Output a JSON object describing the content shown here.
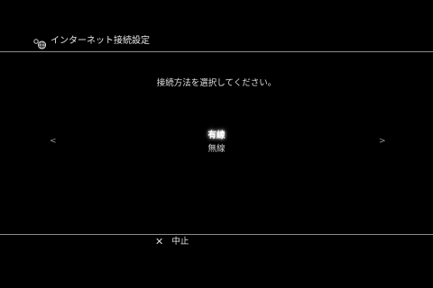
{
  "header": {
    "icon": "network-settings-icon",
    "title": "インターネット接続設定"
  },
  "main": {
    "prompt": "接続方法を選択してください。",
    "options": [
      {
        "label": "有線",
        "selected": true
      },
      {
        "label": "無線",
        "selected": false
      }
    ],
    "left_arrow": "<",
    "right_arrow": ">"
  },
  "footer": {
    "cancel_icon": "cross-button-icon",
    "cancel_glyph": "✕",
    "cancel_label": "中止"
  },
  "colors": {
    "background": "#000000",
    "text": "#e6e6e6",
    "divider": "#8a8a8a",
    "selected_text": "#ffffff"
  }
}
